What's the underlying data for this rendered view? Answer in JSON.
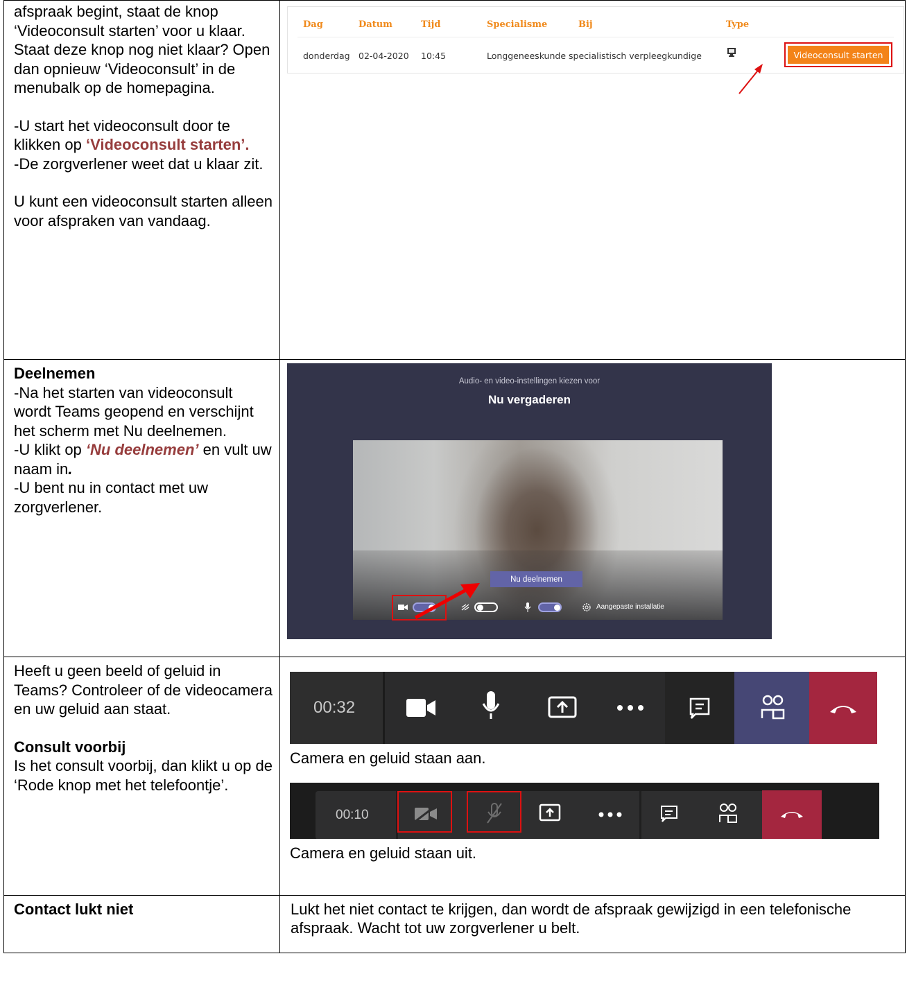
{
  "row1": {
    "left_p1": "afspraak begint, staat de knop ‘Videoconsult starten’ voor u klaar. Staat deze knop nog niet klaar? Open dan opnieuw ‘Videoconsult’ in de menubalk op de homepagina.",
    "left_p2_prefix": "-U start het videoconsult door te klikken op ",
    "left_p2_highlight": "‘Videoconsult starten’.",
    "left_p3": "-De zorgverlener weet dat u klaar zit.",
    "left_p4": "U kunt een videoconsult starten alleen voor afspraken van vandaag.",
    "appt_table": {
      "headers": [
        "Dag",
        "Datum",
        "Tijd",
        "Specialisme",
        "Bij",
        "Type"
      ],
      "row": [
        "donderdag",
        "02-04-2020",
        "10:45",
        "Longgeneeskunde",
        "specialistisch verpleegkundige"
      ],
      "button_label": "Videoconsult starten"
    }
  },
  "row2": {
    "heading": "Deelnemen",
    "p1": "-Na het starten van videoconsult wordt Teams geopend en verschijnt het scherm met Nu deelnemen.",
    "p2_prefix": "-U klikt op ",
    "p2_highlight": "‘Nu deelnemen’",
    "p2_suffix": " en vult uw naam in",
    "p2_end": ".",
    "p3": "-U bent nu in contact met uw zorgverlener.",
    "teams": {
      "subtitle": "Audio- en video-instellingen kiezen voor",
      "title": "Nu vergaderen",
      "join_label": "Nu deelnemen",
      "custom_setup": "Aangepaste installatie"
    }
  },
  "row3": {
    "p1": "Heeft u geen beeld of geluid in Teams? Controleer of de videocamera en uw geluid aan staat.",
    "heading": "Consult voorbij",
    "p2": "Is het consult voorbij, dan klikt u op de ‘Rode knop met het telefoontje’.",
    "bar1_time": "00:32",
    "caption1": "Camera en geluid staan aan.",
    "bar2_time": "00:10",
    "caption2": "Camera en geluid staan uit."
  },
  "row4": {
    "heading": "Contact lukt niet",
    "text": "Lukt het niet contact te krijgen, dan wordt de afspraak gewijzigd in een telefonische afspraak. Wacht tot uw zorgverlener u belt."
  },
  "colors": {
    "accent_orange": "#f38318",
    "highlight_brown": "#963c3c",
    "teams_purple": "#6264a7",
    "hangup_red": "#a4262c",
    "annotation_red": "#dd1111"
  }
}
